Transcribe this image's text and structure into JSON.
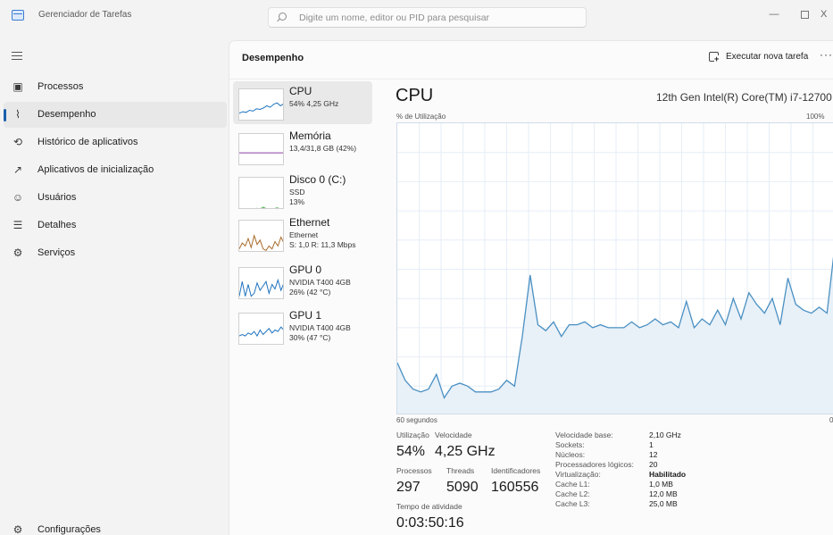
{
  "app": {
    "title": "Gerenciador de Tarefas"
  },
  "search": {
    "placeholder": "Digite um nome, editor ou PID para pesquisar"
  },
  "window_controls": {
    "minimize": "—",
    "close": "X"
  },
  "sidebar": {
    "items": [
      {
        "label": "Processos",
        "icon": "processes-icon",
        "glyph": "▣"
      },
      {
        "label": "Desempenho",
        "icon": "performance-icon",
        "glyph": "⌇"
      },
      {
        "label": "Histórico de aplicativos",
        "icon": "history-icon",
        "glyph": "⟲"
      },
      {
        "label": "Aplicativos de inicialização",
        "icon": "startup-icon",
        "glyph": "↗"
      },
      {
        "label": "Usuários",
        "icon": "users-icon",
        "glyph": "☺"
      },
      {
        "label": "Detalhes",
        "icon": "details-icon",
        "glyph": "☰"
      },
      {
        "label": "Serviços",
        "icon": "services-icon",
        "glyph": "⚙"
      }
    ],
    "active_index": 1,
    "settings": {
      "label": "Configurações",
      "icon": "settings-icon",
      "glyph": "⚙"
    }
  },
  "header": {
    "title": "Desempenho",
    "run_task": "Executar nova tarefa",
    "more": "···"
  },
  "devices": [
    {
      "name": "CPU",
      "line1": "54% 4,25 GHz",
      "line2": "",
      "color": "#1e73be",
      "fill": "none",
      "spark": [
        0.25,
        0.3,
        0.28,
        0.35,
        0.32,
        0.4,
        0.38,
        0.42,
        0.5,
        0.45,
        0.55,
        0.6,
        0.5,
        0.58
      ]
    },
    {
      "name": "Memória",
      "line1": "13,4/31,8 GB (42%)",
      "line2": "",
      "color": "#8b3fa5",
      "fill": "none",
      "spark": [
        0.42,
        0.42,
        0.42,
        0.42,
        0.42,
        0.42,
        0.42,
        0.42
      ]
    },
    {
      "name": "Disco 0 (C:)",
      "line1": "SSD",
      "line2": "13%",
      "color": "#4caf50",
      "fill": "none",
      "spark": [
        0,
        0,
        0,
        0,
        0,
        0.02,
        0,
        0.06,
        0,
        0,
        0,
        0.04,
        0,
        0
      ]
    },
    {
      "name": "Ethernet",
      "line1": "Ethernet",
      "line2": "S: 1,0 R: 11,3 Mbps",
      "color": "#a86b2a",
      "fill": "none",
      "spark": [
        0.1,
        0.3,
        0.2,
        0.45,
        0.15,
        0.55,
        0.25,
        0.4,
        0.1,
        0.05,
        0.2,
        0.1,
        0.35,
        0.2,
        0.5,
        0.3
      ]
    },
    {
      "name": "GPU 0",
      "line1": "NVIDIA T400 4GB",
      "line2": "26% (42 °C)",
      "color": "#1e73be",
      "fill": "none",
      "spark": [
        0.1,
        0.6,
        0.1,
        0.5,
        0.1,
        0.2,
        0.55,
        0.3,
        0.45,
        0.6,
        0.2,
        0.5,
        0.35,
        0.65,
        0.3,
        0.55
      ]
    },
    {
      "name": "GPU 1",
      "line1": "NVIDIA T400 4GB",
      "line2": "30% (47 °C)",
      "color": "#1e73be",
      "fill": "none",
      "spark": [
        0.3,
        0.35,
        0.3,
        0.4,
        0.35,
        0.45,
        0.3,
        0.5,
        0.35,
        0.45,
        0.55,
        0.4,
        0.5,
        0.45,
        0.6,
        0.5
      ]
    }
  ],
  "selected_device": 0,
  "detail": {
    "title": "CPU",
    "model": "12th Gen Intel(R) Core(TM) i7-12700",
    "y_caption": "% de Utilização",
    "y_max": "100%",
    "x_left": "60 segundos",
    "x_right": "0"
  },
  "chart_data": {
    "type": "area",
    "title": "CPU",
    "ylabel": "% de Utilização",
    "xlabel": "60 segundos",
    "ylim": [
      0,
      100
    ],
    "grid": true,
    "color": "#4a90c2",
    "fill": "#e8f0f8",
    "values": [
      18,
      12,
      9,
      8,
      9,
      14,
      6,
      10,
      11,
      10,
      8,
      8,
      8,
      9,
      12,
      10,
      27,
      48,
      31,
      29,
      32,
      27,
      31,
      31,
      32,
      30,
      31,
      30,
      30,
      30,
      32,
      30,
      31,
      33,
      31,
      32,
      30,
      39,
      30,
      33,
      31,
      36,
      31,
      40,
      33,
      42,
      38,
      35,
      40,
      31,
      47,
      38,
      36,
      35,
      37,
      35,
      58
    ]
  },
  "stats": {
    "utilization_label": "Utilização",
    "utilization_value": "54%",
    "speed_label": "Velocidade",
    "speed_value": "4,25 GHz",
    "processes_label": "Processos",
    "processes_value": "297",
    "threads_label": "Threads",
    "threads_value": "5090",
    "handles_label": "Identificadores",
    "handles_value": "160556",
    "uptime_label": "Tempo de atividade",
    "uptime_value": "0:03:50:16"
  },
  "specs": [
    {
      "label": "Velocidade base:",
      "value": "2,10 GHz",
      "bold": false
    },
    {
      "label": "Sockets:",
      "value": "1",
      "bold": false
    },
    {
      "label": "Núcleos:",
      "value": "12",
      "bold": false
    },
    {
      "label": "Processadores lógicos:",
      "value": "20",
      "bold": false
    },
    {
      "label": "Virtualização:",
      "value": "Habilitado",
      "bold": true
    },
    {
      "label": "Cache L1:",
      "value": "1,0 MB",
      "bold": false
    },
    {
      "label": "Cache L2:",
      "value": "12,0 MB",
      "bold": false
    },
    {
      "label": "Cache L3:",
      "value": "25,0 MB",
      "bold": false
    }
  ]
}
